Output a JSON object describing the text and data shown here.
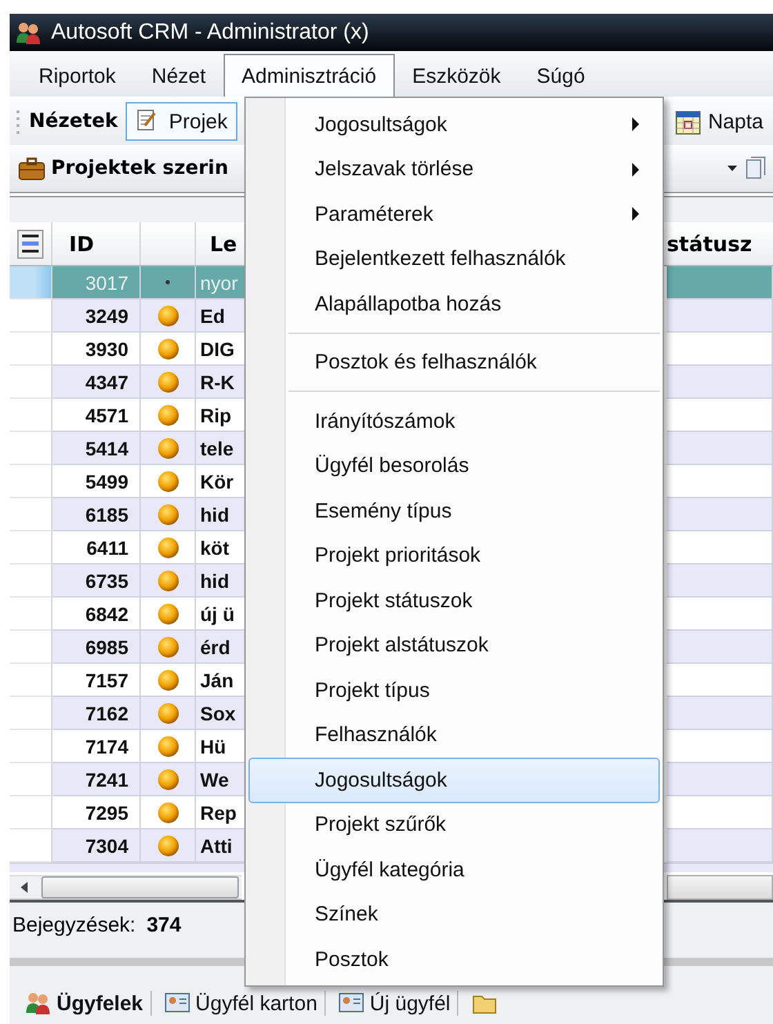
{
  "window": {
    "title": "Autosoft CRM - Administrator (x)"
  },
  "menubar": [
    {
      "label": "Riportok",
      "selected": false
    },
    {
      "label": "Nézet",
      "selected": false
    },
    {
      "label": "Adminisztráció",
      "selected": true
    },
    {
      "label": "Eszközök",
      "selected": false
    },
    {
      "label": "Súgó",
      "selected": false
    }
  ],
  "toolbar": {
    "label": "Nézetek",
    "buttons": [
      {
        "label": "Projek",
        "selected": true
      },
      {
        "label": "Napta",
        "selected": false
      }
    ]
  },
  "view_bar": {
    "title": "Projektek szerin"
  },
  "grid": {
    "columns": [
      "ID",
      "Le",
      "státusz"
    ],
    "rows": [
      {
        "id": "3017",
        "kind": "dot",
        "text": "nyor",
        "selected": true
      },
      {
        "id": "3249",
        "kind": "ball",
        "text": "Ed",
        "selected": false
      },
      {
        "id": "3930",
        "kind": "ball",
        "text": "DIG",
        "selected": false
      },
      {
        "id": "4347",
        "kind": "ball",
        "text": "R-K",
        "selected": false
      },
      {
        "id": "4571",
        "kind": "ball",
        "text": "Rip",
        "selected": false
      },
      {
        "id": "5414",
        "kind": "ball",
        "text": "tele",
        "selected": false
      },
      {
        "id": "5499",
        "kind": "ball",
        "text": "Kör",
        "selected": false
      },
      {
        "id": "6185",
        "kind": "ball",
        "text": "hid",
        "selected": false
      },
      {
        "id": "6411",
        "kind": "ball",
        "text": "köt",
        "selected": false
      },
      {
        "id": "6735",
        "kind": "ball",
        "text": "hid",
        "selected": false
      },
      {
        "id": "6842",
        "kind": "ball",
        "text": "új ü",
        "selected": false
      },
      {
        "id": "6985",
        "kind": "ball",
        "text": "érd",
        "selected": false
      },
      {
        "id": "7157",
        "kind": "ball",
        "text": "Ján",
        "selected": false
      },
      {
        "id": "7162",
        "kind": "ball",
        "text": "Sox",
        "selected": false
      },
      {
        "id": "7174",
        "kind": "ball",
        "text": "Hü",
        "selected": false
      },
      {
        "id": "7241",
        "kind": "ball",
        "text": "We",
        "selected": false
      },
      {
        "id": "7295",
        "kind": "ball",
        "text": "Rep",
        "selected": false
      },
      {
        "id": "7304",
        "kind": "ball",
        "text": "Atti",
        "selected": false
      }
    ]
  },
  "status_bar": {
    "label": "Bejegyzések:",
    "count": "374"
  },
  "bottom_bar": [
    {
      "label": "Ügyfelek",
      "selected": true
    },
    {
      "label": "Ügyfél karton",
      "selected": false
    },
    {
      "label": "Új ügyfél",
      "selected": false
    }
  ],
  "menu": {
    "items": [
      {
        "kind": "item",
        "label": "Jogosultságok",
        "submenu": true,
        "selected": false
      },
      {
        "kind": "item",
        "label": "Jelszavak törlése",
        "submenu": true,
        "selected": false
      },
      {
        "kind": "item",
        "label": "Paraméterek",
        "submenu": true,
        "selected": false
      },
      {
        "kind": "item",
        "label": "Bejelentkezett felhasználók",
        "submenu": false,
        "selected": false
      },
      {
        "kind": "item",
        "label": "Alapállapotba hozás",
        "submenu": false,
        "selected": false
      },
      {
        "kind": "separator"
      },
      {
        "kind": "item",
        "label": "Posztok és felhasználók",
        "submenu": false,
        "selected": false
      },
      {
        "kind": "separator"
      },
      {
        "kind": "item",
        "label": "Irányítószámok",
        "submenu": false,
        "selected": false
      },
      {
        "kind": "item",
        "label": "Ügyfél besorolás",
        "submenu": false,
        "selected": false
      },
      {
        "kind": "item",
        "label": "Esemény típus",
        "submenu": false,
        "selected": false
      },
      {
        "kind": "item",
        "label": "Projekt prioritások",
        "submenu": false,
        "selected": false
      },
      {
        "kind": "item",
        "label": "Projekt státuszok",
        "submenu": false,
        "selected": false
      },
      {
        "kind": "item",
        "label": "Projekt alstátuszok",
        "submenu": false,
        "selected": false
      },
      {
        "kind": "item",
        "label": "Projekt típus",
        "submenu": false,
        "selected": false
      },
      {
        "kind": "item",
        "label": "Felhasználók",
        "submenu": false,
        "selected": false
      },
      {
        "kind": "item",
        "label": "Jogosultságok",
        "submenu": false,
        "selected": true
      },
      {
        "kind": "item",
        "label": "Projekt szűrők",
        "submenu": false,
        "selected": false
      },
      {
        "kind": "item",
        "label": "Ügyfél kategória",
        "submenu": false,
        "selected": false
      },
      {
        "kind": "item",
        "label": "Színek",
        "submenu": false,
        "selected": false
      },
      {
        "kind": "item",
        "label": "Posztok",
        "submenu": false,
        "selected": false
      }
    ]
  }
}
